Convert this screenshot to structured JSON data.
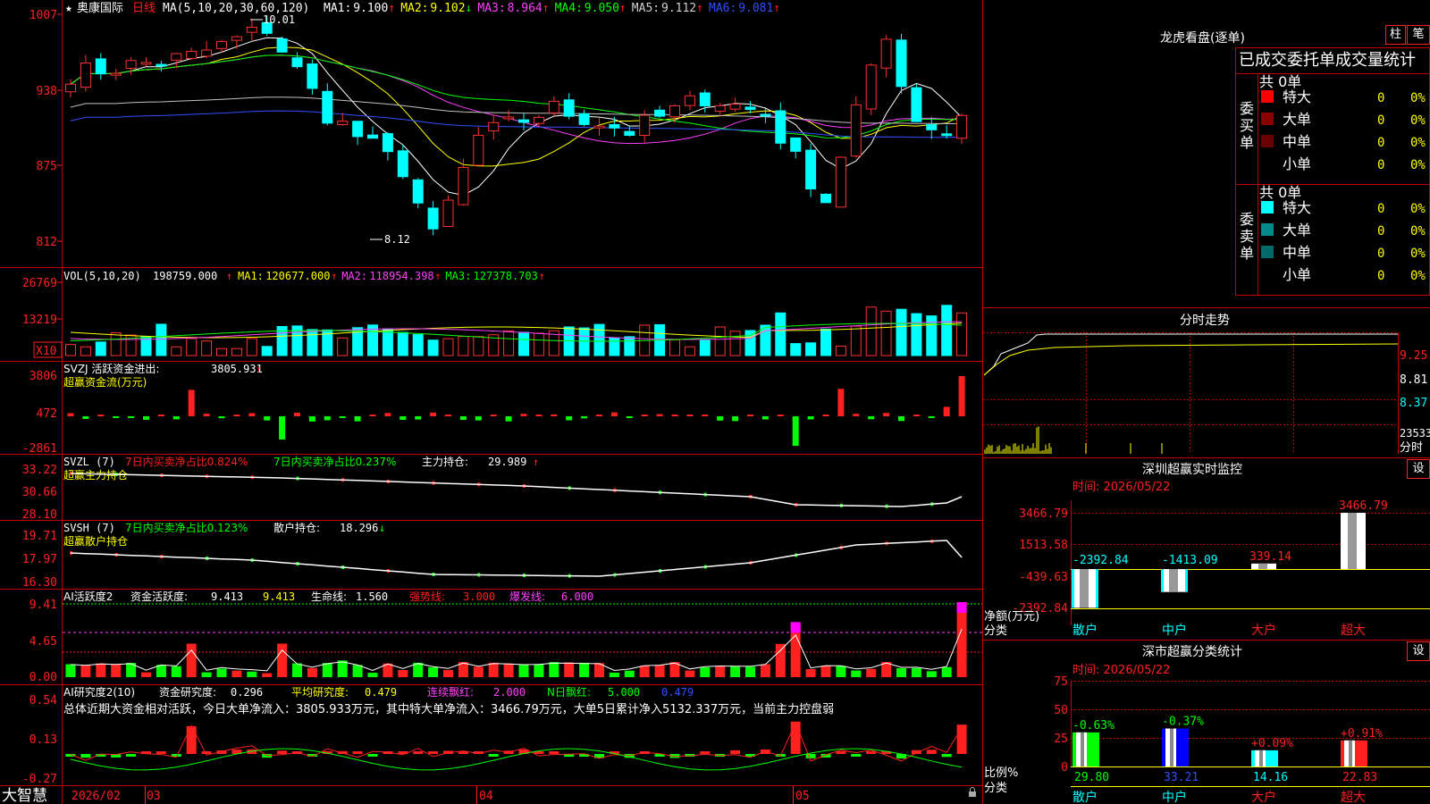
{
  "stock": {
    "name": "奥康国际",
    "period": "日线",
    "ma_params": "MA(5,10,20,30,60,120)",
    "ma_values": [
      {
        "label": "MA1:",
        "value": "9.100",
        "arrow": "↑",
        "color": "#ffffff"
      },
      {
        "label": "MA2:",
        "value": "9.102",
        "arrow": "↓",
        "color": "#ffff00"
      },
      {
        "label": "MA3:",
        "value": "8.964",
        "arrow": "↑",
        "color": "#ff40ff"
      },
      {
        "label": "MA4:",
        "value": "9.050",
        "arrow": "↑",
        "color": "#00ff00"
      },
      {
        "label": "MA5:",
        "value": "9.112",
        "arrow": "↑",
        "color": "#d0d0d0"
      },
      {
        "label": "MA6:",
        "value": "9.081",
        "arrow": "↑",
        "color": "#3050ff"
      }
    ],
    "high_label": "10.01",
    "low_label": "8.12"
  },
  "axes": {
    "price": [
      "1007",
      "938",
      "875",
      "812"
    ],
    "vol": [
      "26769",
      "13219"
    ],
    "vol_unit": "X10",
    "svzj": [
      "3806",
      "472",
      "-2861"
    ],
    "svzl": [
      "33.22",
      "30.66",
      "28.10"
    ],
    "svsh": [
      "19.71",
      "17.97",
      "16.30"
    ],
    "ai": [
      "9.41",
      "4.65",
      "0.00"
    ],
    "ai2": [
      "0.54",
      "0.13",
      "-0.27"
    ]
  },
  "vol_panel": {
    "header": "VOL(5,10,20)",
    "value": "198759.000",
    "arrow": "↑",
    "mas": [
      {
        "label": "MA1:",
        "value": "120677.000",
        "arrow": "↑",
        "color": "#ffff00"
      },
      {
        "label": "MA2:",
        "value": "118954.398",
        "arrow": "↑",
        "color": "#ff40ff"
      },
      {
        "label": "MA3:",
        "value": "127378.703",
        "arrow": "↑",
        "color": "#00ff00"
      }
    ]
  },
  "svzj_panel": {
    "header": "SVZJ  活跃资金进出:",
    "value": "3805.931",
    "arrow": "↑",
    "sub": "超赢资金流(万元)"
  },
  "svzl_panel": {
    "header": "SVZL (7)",
    "red_text": "7日内买卖净占比0.824%",
    "green_text": "7日内买卖净占比0.237%",
    "hold_label": "主力持仓:",
    "hold_value": "29.989",
    "arrow": "↑",
    "sub": "超赢主力持仓"
  },
  "svsh_panel": {
    "header": "SVSH (7)",
    "green_text": "7日内买卖净占比0.123%",
    "hold_label": "散户持仓:",
    "hold_value": "18.296",
    "arrow": "↓",
    "sub": "超赢散户持仓"
  },
  "ai_panel": {
    "header": "AI活跃度2",
    "label": "资金活跃度:",
    "value": "9.413",
    "value2": "9.413",
    "life_label": "生命线:",
    "life_value": "1.560",
    "strong_label": "强势线:",
    "strong_value": "3.000",
    "burst_label": "爆发线:",
    "burst_value": "6.000"
  },
  "ai2_panel": {
    "header": "AI研究度2(10)",
    "label": "资金研究度:",
    "value": "0.296",
    "avg_label": "平均研究度:",
    "avg_value": "0.479",
    "red_label": "连续飘红:",
    "red_value": "2.000",
    "n_label": "N日飘红:",
    "n_value": "5.000",
    "last_value": "0.479",
    "summary": "总体近期大资金相对活跃，今日大单净流入：3805.933万元，其中特大单净流入：3466.79万元，大单5日累计净入5132.337万元，当前主力控盘弱"
  },
  "dates": {
    "logo": "大智慧",
    "labels": [
      "2026/02",
      "03",
      "04",
      "05"
    ]
  },
  "dragon": {
    "title": "龙虎看盘(逐单)",
    "btn_zhu": "柱",
    "btn_bi": "笔",
    "header": "已成交委托单成交量统计",
    "buy_label": "委买单",
    "sell_label": "委卖单",
    "buy_total": "共 0单",
    "sell_total": "共 0单",
    "rows": [
      "特大",
      "大单",
      "中单",
      "小单"
    ],
    "buy_colors": [
      "#ff0000",
      "#8b0000",
      "#6a0000",
      "#000000"
    ],
    "sell_colors": [
      "#00ffff",
      "#008b8b",
      "#006a6a",
      "#000000"
    ],
    "count": "0",
    "pct": "0%"
  },
  "intraday": {
    "title": "分时走势",
    "prices": [
      "9.25",
      "8.81",
      "8.37"
    ],
    "vol": "23533",
    "unit": "分时"
  },
  "monitor": {
    "title": "深圳超赢实时监控",
    "btn": "设",
    "time": "时间: 2026/05/22",
    "y_axis": [
      "3466.79",
      "1513.58",
      "-439.63",
      "-2392.84"
    ],
    "bar_values": [
      "-2392.84",
      "-1413.09",
      "339.14",
      "3466.79"
    ],
    "left_label1": "净额(万元)",
    "left_label2": "分类",
    "categories": [
      "散户",
      "中户",
      "大户",
      "超大"
    ]
  },
  "classify": {
    "title": "深市超赢分类统计",
    "btn": "设",
    "time": "时间: 2026/05/22",
    "y_axis": [
      "75",
      "50",
      "25",
      "0"
    ],
    "pct_values": [
      "-0.63%",
      "-0.37%",
      "+0.09%",
      "+0.91%"
    ],
    "bar_values": [
      "29.80",
      "33.21",
      "14.16",
      "22.83"
    ],
    "left_label1": "比例%",
    "left_label2": "分类",
    "categories": [
      "散户",
      "中户",
      "大户",
      "超大"
    ]
  }
}
